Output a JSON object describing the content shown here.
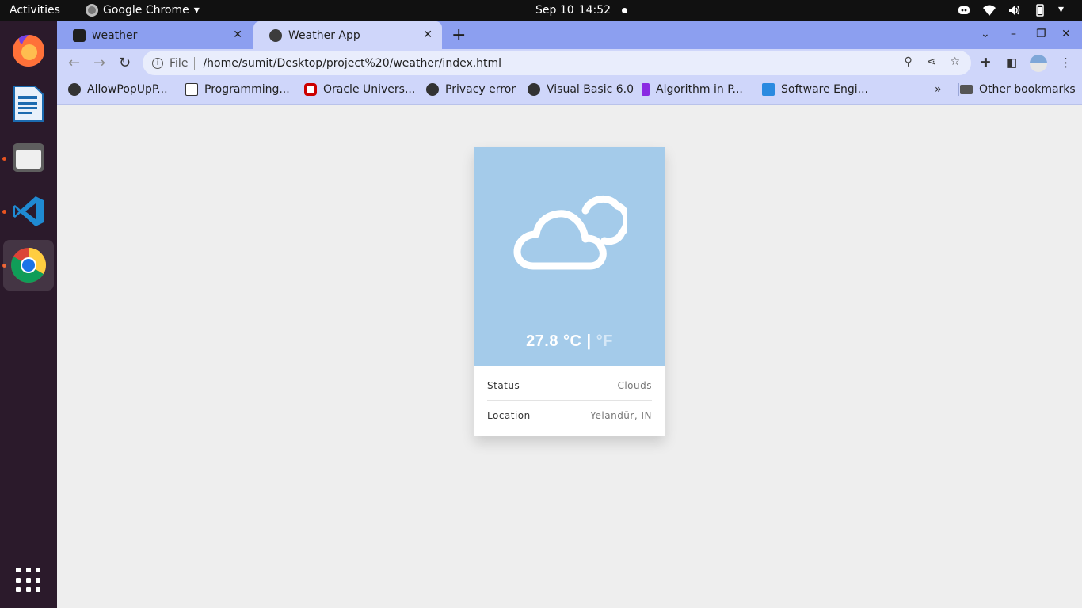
{
  "os": {
    "activities": "Activities",
    "app_name": "Google Chrome",
    "date": "Sep 10",
    "time": "14:52"
  },
  "tabs": [
    {
      "title": "weather",
      "active": false
    },
    {
      "title": "Weather App",
      "active": true
    }
  ],
  "address_bar": {
    "scheme_label": "File",
    "url": "/home/sumit/Desktop/project%20/weather/index.html"
  },
  "bookmarks": [
    {
      "label": "AllowPopUpP...",
      "icon": "globe-icon"
    },
    {
      "label": "Programming...",
      "icon": "book-icon"
    },
    {
      "label": "Oracle Univers...",
      "icon": "oracle-icon"
    },
    {
      "label": "Privacy error",
      "icon": "globe-icon"
    },
    {
      "label": "Visual Basic 6.0",
      "icon": "globe-icon"
    },
    {
      "label": "Algorithm in P...",
      "icon": "p-icon"
    },
    {
      "label": "Software Engi...",
      "icon": "site-icon"
    }
  ],
  "bookmarks_more": "»",
  "other_bookmarks": "Other bookmarks",
  "weather": {
    "temperature": "27.8 °C |",
    "alt_unit": "°F",
    "status_label": "Status",
    "status_value": "Clouds",
    "location_label": "Location",
    "location_value": "Yelandūr, IN",
    "sky_color": "#a4cbea"
  }
}
